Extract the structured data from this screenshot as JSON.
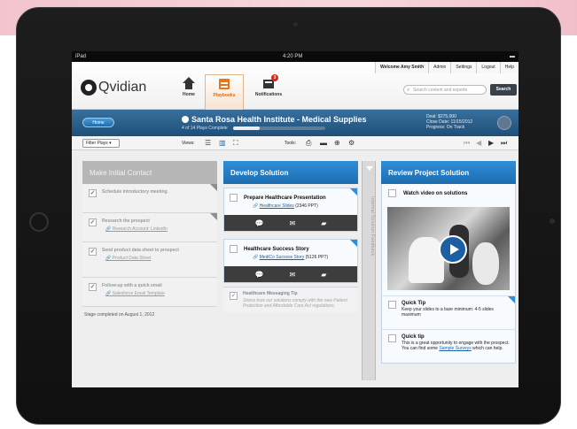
{
  "status_bar": {
    "device": "iPad",
    "time": "4:20 PM"
  },
  "header": {
    "brand": "Qvidian",
    "nav": [
      {
        "label": "Home",
        "icon": "home-icon"
      },
      {
        "label": "Playbooks",
        "icon": "playbook-icon",
        "active": true
      },
      {
        "label": "Notifications",
        "icon": "notification-icon",
        "badge": "3"
      }
    ],
    "top_links": {
      "welcome": "Welcome Amy Smith",
      "admin": "Admin",
      "settings": "Settings",
      "logout": "Logout",
      "help": "Help"
    },
    "search": {
      "placeholder": "Search content and experts",
      "button": "Search"
    }
  },
  "project_bar": {
    "home_button": "Home",
    "title": "Santa Rosa Health Institute - Medical Supplies",
    "subtitle": "4 of 14 Plays Complete",
    "progress": 0.29,
    "deal_lines": [
      "Deal: $275,000",
      "Close Date: 11/15/2012",
      "Progress: On Track"
    ]
  },
  "toolbar": {
    "filter_label": "Filter Plays",
    "views_label": "Views:",
    "tools_label": "Tools:"
  },
  "columns": {
    "contact": {
      "title": "Make Initial Contact",
      "items": [
        {
          "label": "Schedule introductory meeting",
          "link": ""
        },
        {
          "label": "Research the prospect",
          "link": "Research Account: LinkedIn"
        },
        {
          "label": "Send product data sheet to prospect",
          "link": "Product Data Sheet"
        },
        {
          "label": "Follow-up with a quick email",
          "link": "Salesforce Email Template"
        }
      ],
      "footer": "Stage completed on August 1, 2012"
    },
    "develop": {
      "title": "Develop Solution",
      "cards": [
        {
          "title": "Prepare Healthcare Presentation",
          "file": "Healthcare Slides",
          "meta": "(2346 PPT)"
        },
        {
          "title": "Healthcare Success Story",
          "file": "MediCo Success Story",
          "meta": "(5126 PPT)"
        }
      ],
      "tip": {
        "title": "Healthcare Messaging Tip",
        "body": "Stress how our solutions comply with the new Patient Protection and Affordable Care Act regulations."
      }
    },
    "side_tab": "Internal Solution Feedback",
    "review": {
      "title": "Review Project Solution",
      "video_title": "Watch video on solutions",
      "tips": [
        {
          "title": "Quick Tip",
          "body": "Keep your slides to a bare minimum: 4-5 slides maximum"
        },
        {
          "title": "Quick tip",
          "body": "This is a great opportunity to engage with the prospect. You can find some",
          "link": "Sample Surveys",
          "tail": "which can help."
        }
      ]
    }
  }
}
